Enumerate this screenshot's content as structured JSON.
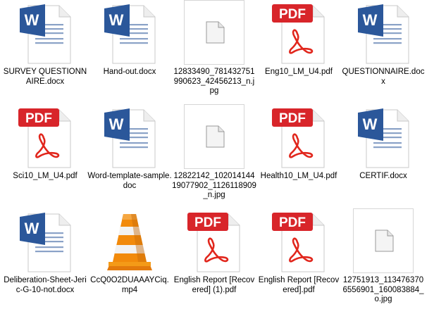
{
  "colors": {
    "word_blue": "#2b579a",
    "pdf_red": "#d8252a",
    "acrobat_red": "#e1261c",
    "vlc_orange": "#f28a0b"
  },
  "files": [
    {
      "name": "SURVEY QUESTIONNAIRE.docx",
      "icon": "word-doc-icon"
    },
    {
      "name": "Hand-out.docx",
      "icon": "word-doc-icon"
    },
    {
      "name": "12833490_781432751990623_42456213_n.jpg",
      "icon": "blank-image-icon"
    },
    {
      "name": "Eng10_LM_U4.pdf",
      "icon": "pdf-icon"
    },
    {
      "name": "QUESTIONNAIRE.docx",
      "icon": "word-doc-icon"
    },
    {
      "name": "Sci10_LM_U4.pdf",
      "icon": "pdf-icon"
    },
    {
      "name": "Word-template-sample.doc",
      "icon": "word-doc-icon"
    },
    {
      "name": "12822142_10201414419077902_1126118909_n.jpg",
      "icon": "blank-image-icon"
    },
    {
      "name": "Health10_LM_U4.pdf",
      "icon": "pdf-icon"
    },
    {
      "name": "CERTIF.docx",
      "icon": "word-doc-icon"
    },
    {
      "name": "Deliberation-Sheet-Jeric-G-10-not.docx",
      "icon": "word-doc-icon"
    },
    {
      "name": "CcQ0O2DUAAAYCiq.mp4",
      "icon": "vlc-cone-icon"
    },
    {
      "name": "English Report [Recovered] (1).pdf",
      "icon": "pdf-icon"
    },
    {
      "name": "English Report [Recovered].pdf",
      "icon": "pdf-icon"
    },
    {
      "name": "12751913_1134763706556901_160083884_o.jpg",
      "icon": "blank-image-icon"
    }
  ],
  "pdf_badge_label": "PDF",
  "word_badge_letter": "W"
}
